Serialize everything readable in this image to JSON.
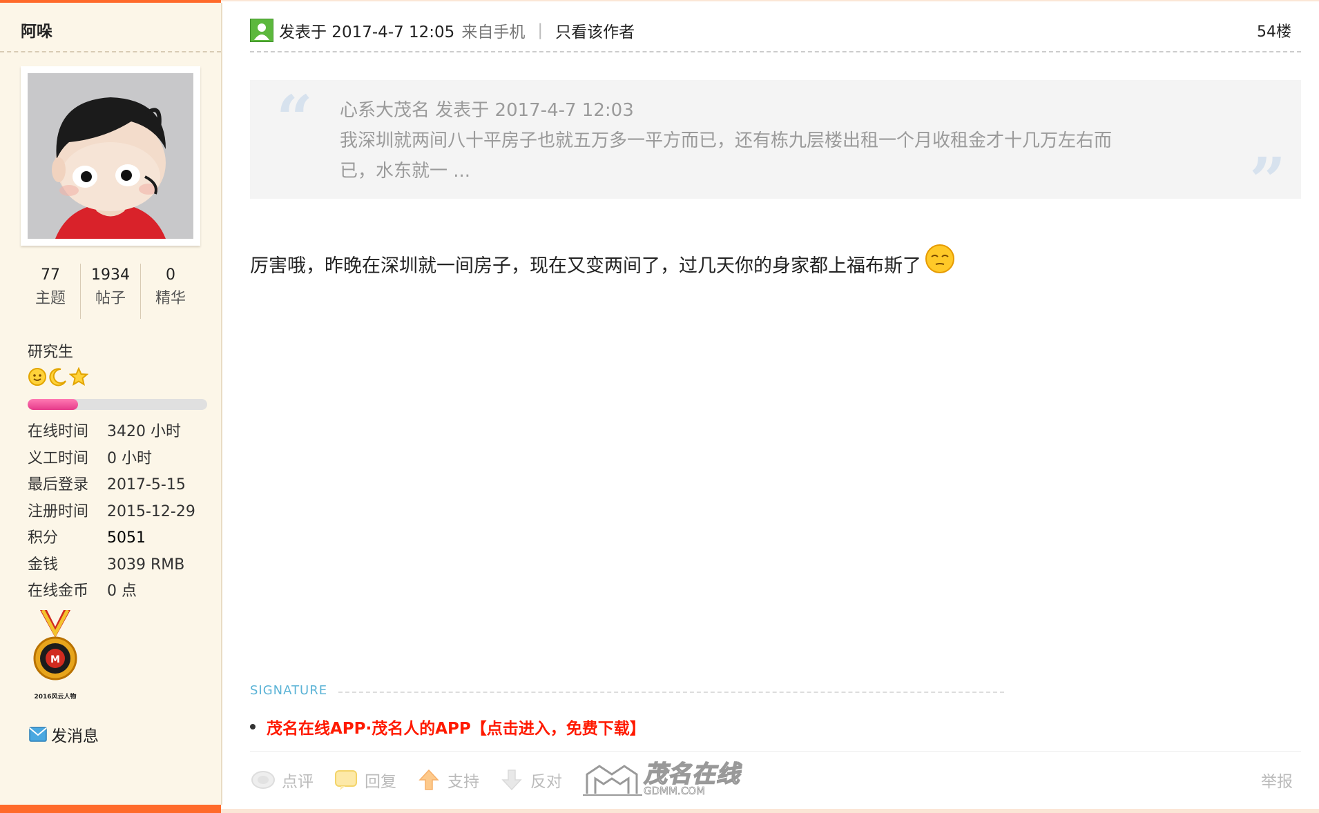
{
  "author": {
    "name": "阿哚",
    "stats": [
      {
        "num": "77",
        "label": "主题"
      },
      {
        "num": "1934",
        "label": "帖子"
      },
      {
        "num": "0",
        "label": "精华"
      }
    ],
    "rank": "研究生",
    "rank_progress": 0.28,
    "info": [
      {
        "label": "在线时间",
        "value": "3420 小时"
      },
      {
        "label": "义工时间",
        "value": "0 小时"
      },
      {
        "label": "最后登录",
        "value": "2017-5-15"
      },
      {
        "label": "注册时间",
        "value": "2015-12-29"
      },
      {
        "label": "积分",
        "value": "5051"
      },
      {
        "label": "金钱",
        "value": "3039 RMB"
      },
      {
        "label": "在线金币",
        "value": "0 点"
      }
    ],
    "medal_caption": "2016风云人物",
    "send_message": "发消息"
  },
  "post": {
    "time": "发表于 2017-4-7 12:05",
    "source": "来自手机",
    "separator": "|",
    "only_author": "只看该作者",
    "floor": "54楼",
    "quote": {
      "header": "心系大茂名 发表于 2017-4-7 12:03",
      "text": "我深圳就两间八十平房子也就五万多一平方而已，还有栋九层楼出租一个月收租金才十几万左右而已，水东就一 ..."
    },
    "content": "厉害哦，昨晚在深圳就一间房子，现在又变两间了，过几天你的身家都上福布斯了",
    "signature_label": "SIGNATURE",
    "signature_link": "茂名在线APP·茂名人的APP【点击进入，免费下载】",
    "actions": [
      {
        "id": "comment",
        "label": "点评"
      },
      {
        "id": "reply",
        "label": "回复"
      },
      {
        "id": "support",
        "label": "支持"
      },
      {
        "id": "oppose",
        "label": "反对"
      }
    ],
    "report": "举报",
    "watermark": "茂名在线",
    "watermark_sub": "GDMM.COM"
  },
  "colors": {
    "accent": "#ff6a2a",
    "sidebar_bg": "#fcf6e8",
    "signature_link": "#ff1a00",
    "progress": "#e63a8a"
  }
}
